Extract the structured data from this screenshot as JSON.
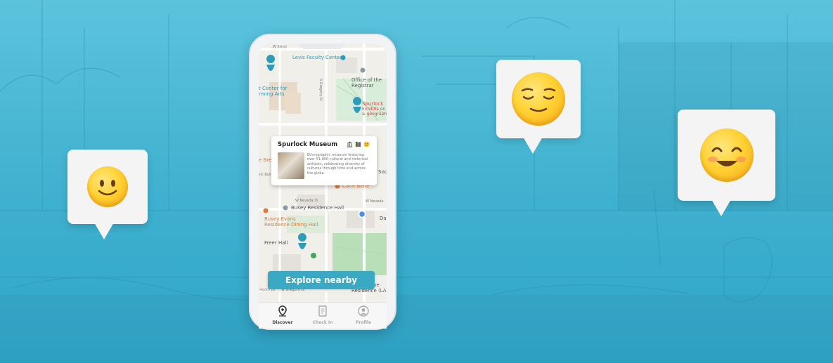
{
  "map": {
    "labels": {
      "w_illinois": "W Illinoi",
      "levis": "Levis Faculty Center",
      "office_registrar": "Office of the Registrar",
      "arts_center": "t Center for\nrming Arts",
      "s_gregory": "S Gregory St",
      "spurlock": "Spurlock",
      "spurlock_sub": "Exhibits on\n& geograph",
      "e_bre": "e Bre",
      "soc": "Soc",
      "caffe_bene": "Caffe Bene",
      "w_nevada_left": "W Nevada St",
      "w_nevada_right": "W Nevada",
      "busey_hall": "Busey Residence Hall",
      "busey_evans": "Busey Evans\nResidence Dining Hall",
      "dan": "Dar",
      "freer_hall": "Freer Hall",
      "sic_build": "sic Build",
      "gregory_dr_left": "regory Dr",
      "w_gregory_dr": "W Gregory Dr",
      "lincoln_ave": "Lincoln Ave\nResidence (LA"
    }
  },
  "card": {
    "title": "Spurlock Museum",
    "description": "Ethnographic museum featuring over 51,000 cultural and historical artifacts, celebrating diversity of cultures through time and across the globe.",
    "icons": [
      "museum-icon",
      "book-icon",
      "neutral-face-icon"
    ]
  },
  "explore_button": "Explore nearby",
  "tabs": [
    {
      "label": "Discover",
      "icon": "map-pin-icon",
      "active": true
    },
    {
      "label": "Check In",
      "icon": "clipboard-icon",
      "active": false
    },
    {
      "label": "Profile",
      "icon": "user-icon",
      "active": false
    }
  ],
  "bubbles": [
    {
      "emoji": "slightly-smiling-face-icon"
    },
    {
      "emoji": "relieved-face-icon"
    },
    {
      "emoji": "smiling-face-with-smiling-eyes-icon"
    }
  ],
  "colors": {
    "background": "#3fb0cf",
    "accent": "#3aa9c3",
    "map_pin": "#2e9bb8"
  }
}
